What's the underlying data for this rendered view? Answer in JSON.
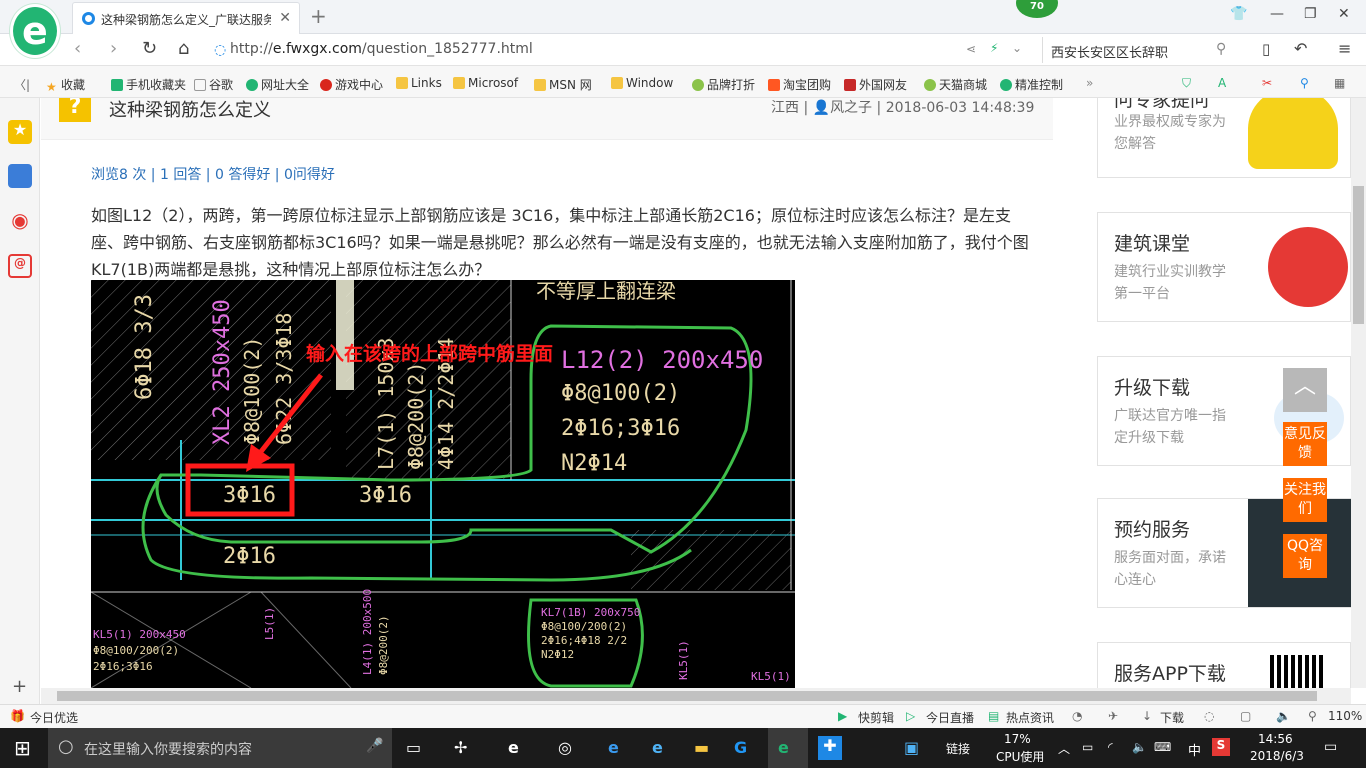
{
  "browser": {
    "tab_title": "这种梁钢筋怎么定义_广联达服务",
    "badge": "70",
    "url_prefix": "http://",
    "url_domain": "e.fwxgx.com",
    "url_path": "/question_1852777.html",
    "search_text": "西安长安区区长辞职"
  },
  "favorites": [
    "收藏",
    "手机收藏夹",
    "谷歌",
    "网址大全",
    "游戏中心",
    "Links",
    "Microsof",
    "MSN 网",
    "Window",
    "品牌打折",
    "淘宝团购",
    "外国网友",
    "天猫商城",
    "精准控制"
  ],
  "question": {
    "title": "这种梁钢筋怎么定义",
    "region": "江西",
    "author": "风之子",
    "datetime": "2018-06-03 14:48:39",
    "stats": {
      "views": "浏览8 次",
      "answers": "1 回答",
      "score": "0 答得好",
      "asks": "0问得好"
    },
    "body": "如图L12（2），两跨，第一跨原位标注显示上部钢筋应该是 3C16，集中标注上部通长筋2C16；原位标注时应该怎么标注？是左支座、跨中钢筋、右支座钢筋都标3C16吗？如果一端是悬挑呢？那么必然有一端是没有支座的，也就无法输入支座附加筋了，我付个图KL7(1B)两端都是悬挑，这种情况上部原位标注怎么办？"
  },
  "cad": {
    "annotation": "输入在该跨的上部跨中筋里面",
    "top_label": "不等厚上翻连梁",
    "labels": [
      "6Φ18 3/3",
      "XL2 250x450",
      "Φ8@100(2)",
      "6Φ22 3/3Φ18",
      "L7(1) 150x3",
      "Φ8@200(2)",
      "4Φ14 2/2Φ14",
      "L12(2) 200x450",
      "Φ8@100(2)",
      "2Φ16;3Φ16",
      "N2Φ14",
      "3Φ16",
      "3Φ16",
      "2Φ16"
    ],
    "small_labels": [
      "KL5(1) 200x450",
      "Φ8@100/200(2)",
      "2Φ16;3Φ16",
      "L5(1)",
      "L4(1) 200x500",
      "Φ8@200(2)",
      "KL7(1B) 200x750",
      "Φ8@100/200(2)",
      "2Φ16;4Φ18 2/2",
      "N2Φ12",
      "KL5(1)",
      "KL5(1)"
    ]
  },
  "sidebar": [
    {
      "title": "问专家提问",
      "sub": "业界最权威专家为您解答"
    },
    {
      "title": "建筑课堂",
      "sub": "建筑行业实训教学第一平台"
    },
    {
      "title": "升级下载",
      "sub": "广联达官方唯一指定升级下载"
    },
    {
      "title": "预约服务",
      "sub": "服务面对面，承诺心连心"
    },
    {
      "title": "服务APP下载",
      "sub": ""
    }
  ],
  "float_buttons": [
    "意见反馈",
    "关注我们",
    "QQ咨询"
  ],
  "statusbar": {
    "left": "今日优选",
    "items": [
      "快剪辑",
      "今日直播",
      "热点资讯",
      "下载"
    ],
    "zoom": "110%"
  },
  "taskbar": {
    "search_placeholder": "在这里输入你要搜索的内容",
    "link": "链接",
    "cpu": "17%",
    "cpu_label": "CPU使用",
    "ime": "中",
    "time": "14:56",
    "date": "2018/6/3"
  },
  "colors": {
    "accent_green": "#22b573",
    "cad_green": "#3fbf4a",
    "cad_red": "#ff1a1a",
    "cad_magenta": "#e070e0",
    "link_blue": "#2a6fb8",
    "float_orange": "#ff6a00"
  }
}
